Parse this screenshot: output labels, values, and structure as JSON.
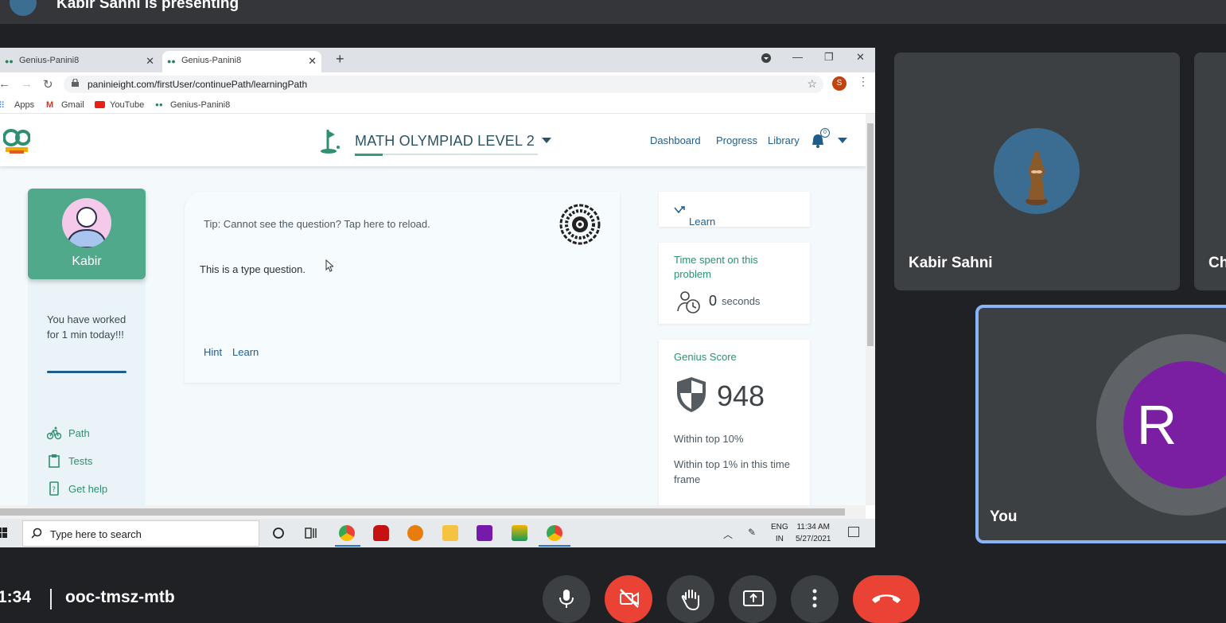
{
  "meet": {
    "presenter_text": "Kabir Sahni is presenting",
    "time": "1:34",
    "meeting_code": "ooc-tmsz-mtb",
    "participants": [
      {
        "name": "Kabir Sahni"
      },
      {
        "name": "Ch"
      },
      {
        "name": "You",
        "initial": "R"
      }
    ],
    "controls": [
      "microphone",
      "camera-off",
      "raise-hand",
      "present-screen",
      "more-options",
      "leave-call"
    ],
    "colors": {
      "background": "#202124",
      "tile": "#3c4043",
      "danger": "#ea4335",
      "highlight": "#8ab4f8",
      "you_avatar": "#7b1fa2"
    }
  },
  "browser": {
    "tabs": [
      {
        "title": "Genius-Panini8",
        "active": false
      },
      {
        "title": "Genius-Panini8",
        "active": true
      }
    ],
    "url": "paninieight.com/firstUser/continuePath/learningPath",
    "profile_initial": "S",
    "bookmarks": [
      "Apps",
      "Gmail",
      "YouTube",
      "Genius-Panini8"
    ]
  },
  "site": {
    "course": "MATH OLYMPIAD LEVEL 2",
    "nav": [
      "Dashboard",
      "Progress",
      "Library"
    ],
    "notification_count": "0",
    "user": {
      "name": "Kabir"
    },
    "work_text": "You have worked for 1 min today!!!",
    "sidebar": [
      {
        "label": "Path",
        "icon": "bicycle-icon"
      },
      {
        "label": "Tests",
        "icon": "clipboard-icon"
      },
      {
        "label": "Get help",
        "icon": "help-icon"
      }
    ],
    "question": {
      "tip": "Tip: Cannot see the question? Tap here to reload.",
      "text": "This is a type question.",
      "hint_label": "Hint",
      "learn_label": "Learn"
    },
    "learn_card": "Learn",
    "time_card": {
      "title": "Time spent on this problem",
      "value": "0",
      "unit": "seconds"
    },
    "score_card": {
      "title": "Genius Score",
      "value": "948",
      "rank_top": "Within top 10%",
      "rank_time": "Within top 1% in this time frame"
    },
    "colors": {
      "primary_green": "#4fa98a",
      "link_blue": "#1f5d8c"
    }
  },
  "taskbar": {
    "search_placeholder": "Type here to search",
    "lang_line1": "ENG",
    "lang_line2": "IN",
    "time": "11:34 AM",
    "date": "5/27/2021"
  }
}
